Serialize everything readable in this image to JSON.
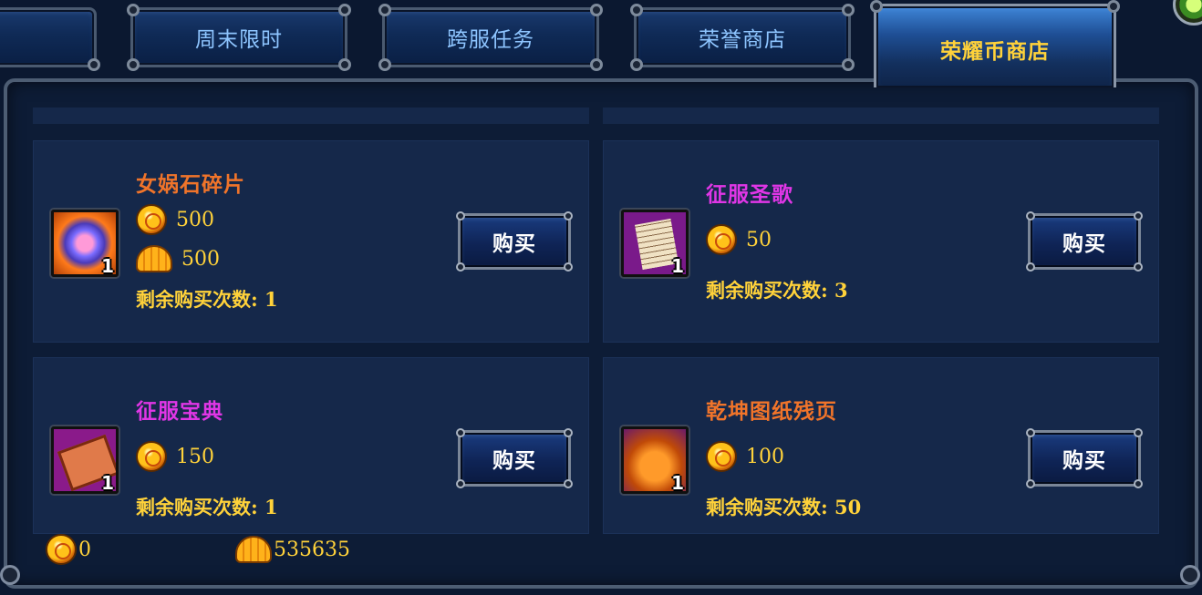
{
  "tabs": [
    {
      "label": ""
    },
    {
      "label": "周末限时"
    },
    {
      "label": "跨服任务"
    },
    {
      "label": "荣誉商店"
    },
    {
      "label": "荣耀币商店"
    }
  ],
  "active_tab": "荣耀币商店",
  "items": [
    {
      "name": "女娲石碎片",
      "name_color": "#f0742a",
      "icon": "gem-fragment-icon",
      "quantity": "1",
      "prices": [
        {
          "currency_icon": "glory-coin-icon",
          "value": "500"
        },
        {
          "currency_icon": "shell-icon",
          "value": "500"
        }
      ],
      "remaining": "剩余购买次数: 1",
      "buy_label": "购买"
    },
    {
      "name": "征服圣歌",
      "name_color": "#e036e6",
      "icon": "scroll-icon",
      "quantity": "1",
      "prices": [
        {
          "currency_icon": "glory-coin-icon",
          "value": "50"
        }
      ],
      "remaining": "剩余购买次数: 3",
      "buy_label": "购买"
    },
    {
      "name": "征服宝典",
      "name_color": "#e036e6",
      "icon": "book-icon",
      "quantity": "1",
      "prices": [
        {
          "currency_icon": "glory-coin-icon",
          "value": "150"
        }
      ],
      "remaining": "剩余购买次数: 1",
      "buy_label": "购买"
    },
    {
      "name": "乾坤图纸残页",
      "name_color": "#f0742a",
      "icon": "blueprint-page-icon",
      "quantity": "1",
      "prices": [
        {
          "currency_icon": "glory-coin-icon",
          "value": "100"
        }
      ],
      "remaining": "剩余购买次数: 50",
      "buy_label": "购买"
    }
  ],
  "balances": {
    "glory_coin": "0",
    "shell": "535635"
  },
  "colors": {
    "active_tab_text": "#ffd23a",
    "tab_text": "#8ec5ff",
    "price_text": "#ffd23a"
  }
}
